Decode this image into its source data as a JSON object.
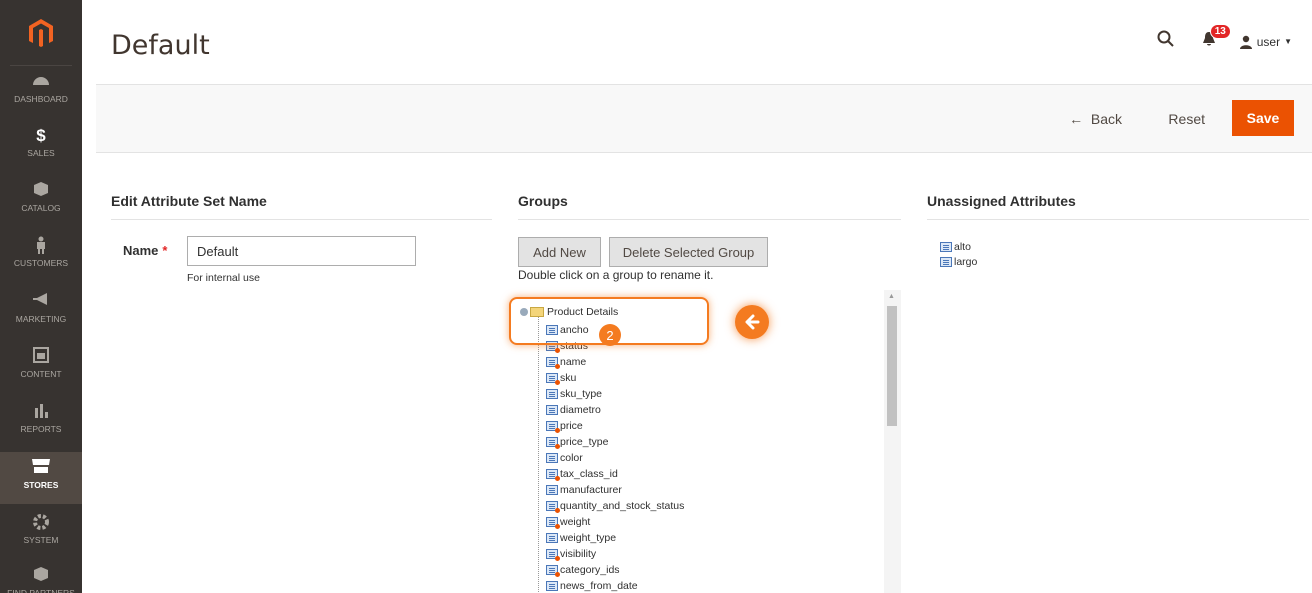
{
  "page": {
    "title": "Default"
  },
  "header": {
    "notifications_count": "13",
    "user_label": "user"
  },
  "sidebar": {
    "items": [
      {
        "label": "DASHBOARD",
        "icon": "dashboard-icon"
      },
      {
        "label": "SALES",
        "icon": "dollar-icon"
      },
      {
        "label": "CATALOG",
        "icon": "box-icon"
      },
      {
        "label": "CUSTOMERS",
        "icon": "person-icon"
      },
      {
        "label": "MARKETING",
        "icon": "megaphone-icon"
      },
      {
        "label": "CONTENT",
        "icon": "layout-icon"
      },
      {
        "label": "REPORTS",
        "icon": "bar-chart-icon"
      },
      {
        "label": "STORES",
        "icon": "store-icon"
      },
      {
        "label": "SYSTEM",
        "icon": "gear-icon"
      },
      {
        "label": "FIND PARTNERS",
        "icon": "cube-icon"
      }
    ]
  },
  "actions": {
    "back": "Back",
    "reset": "Reset",
    "save": "Save"
  },
  "edit_set": {
    "title": "Edit Attribute Set Name",
    "name_label": "Name",
    "name_value": "Default",
    "note": "For internal use"
  },
  "groups": {
    "title": "Groups",
    "add_new": "Add New",
    "delete_group": "Delete Selected Group",
    "note": "Double click on a group to rename it.",
    "root": "Product Details",
    "items": [
      {
        "label": "ancho",
        "system": false
      },
      {
        "label": "status",
        "system": true
      },
      {
        "label": "name",
        "system": true
      },
      {
        "label": "sku",
        "system": true
      },
      {
        "label": "sku_type",
        "system": false
      },
      {
        "label": "diametro",
        "system": false
      },
      {
        "label": "price",
        "system": true
      },
      {
        "label": "price_type",
        "system": true
      },
      {
        "label": "color",
        "system": false
      },
      {
        "label": "tax_class_id",
        "system": true
      },
      {
        "label": "manufacturer",
        "system": false
      },
      {
        "label": "quantity_and_stock_status",
        "system": true
      },
      {
        "label": "weight",
        "system": true
      },
      {
        "label": "weight_type",
        "system": false
      },
      {
        "label": "visibility",
        "system": true
      },
      {
        "label": "category_ids",
        "system": true
      },
      {
        "label": "news_from_date",
        "system": false
      }
    ]
  },
  "unassigned": {
    "title": "Unassigned Attributes",
    "items": [
      "alto",
      "largo"
    ]
  },
  "annotation": {
    "step": "2"
  },
  "colors": {
    "accent": "#eb5202",
    "sidebar": "#373330",
    "highlight": "#f47b20"
  }
}
